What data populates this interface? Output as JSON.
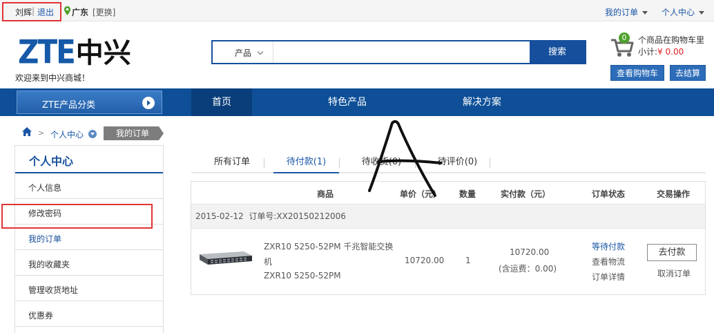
{
  "topbar": {
    "user_name": "刘辉",
    "separator": "|",
    "logout": "退出",
    "location": "广东",
    "change_location": "[更换]",
    "my_orders": "我的订单",
    "personal_center": "个人中心"
  },
  "header": {
    "logo_latin": "ZTE",
    "logo_cn": "中兴",
    "welcome": "欢迎来到中兴商城！",
    "search": {
      "category": "产品",
      "value": "",
      "button": "搜索"
    },
    "cart": {
      "count": "0",
      "text": "个商品在购物车里",
      "subtotal_label": "小计:",
      "subtotal_value": "¥ 0.00",
      "view_cart": "查看购物车",
      "checkout": "去结算"
    }
  },
  "nav": {
    "category_button": "ZTE产品分类",
    "items": [
      "首页",
      "特色产品",
      "解决方案"
    ]
  },
  "breadcrumb": {
    "center": "个人中心",
    "sep": ">",
    "current": "我的订单"
  },
  "sidebar": {
    "title": "个人中心",
    "items": [
      "个人信息",
      "修改密码",
      "我的订单",
      "我的收藏夹",
      "管理收货地址",
      "优惠券"
    ]
  },
  "tabs": [
    "所有订单",
    "待付款(1)",
    "待收货(0)",
    "待评价(0)"
  ],
  "table": {
    "headers": [
      "商品",
      "单价（元）",
      "数量",
      "实付款（元）",
      "订单状态",
      "交易操作"
    ],
    "order": {
      "date": "2015-02-12",
      "number": "订单号:XX20150212006"
    },
    "item": {
      "name_line1": "ZXR10 5250-52PM 千兆智能交换",
      "name_line2": "机",
      "model": "ZXR10 5250-52PM",
      "unit_price": "10720.00",
      "quantity": "1",
      "paid": "10720.00",
      "shipping": "(含运费：0.00)",
      "status": "等待付款",
      "view_logistics": "查看物流",
      "order_detail": "订单详情",
      "pay_button": "去付款",
      "cancel": "取消订单"
    }
  },
  "colors": {
    "brand_blue": "#164f9c",
    "nav_blue": "#0e4f97",
    "highlight_red": "#e03333",
    "cart_green": "#4ea12c"
  }
}
